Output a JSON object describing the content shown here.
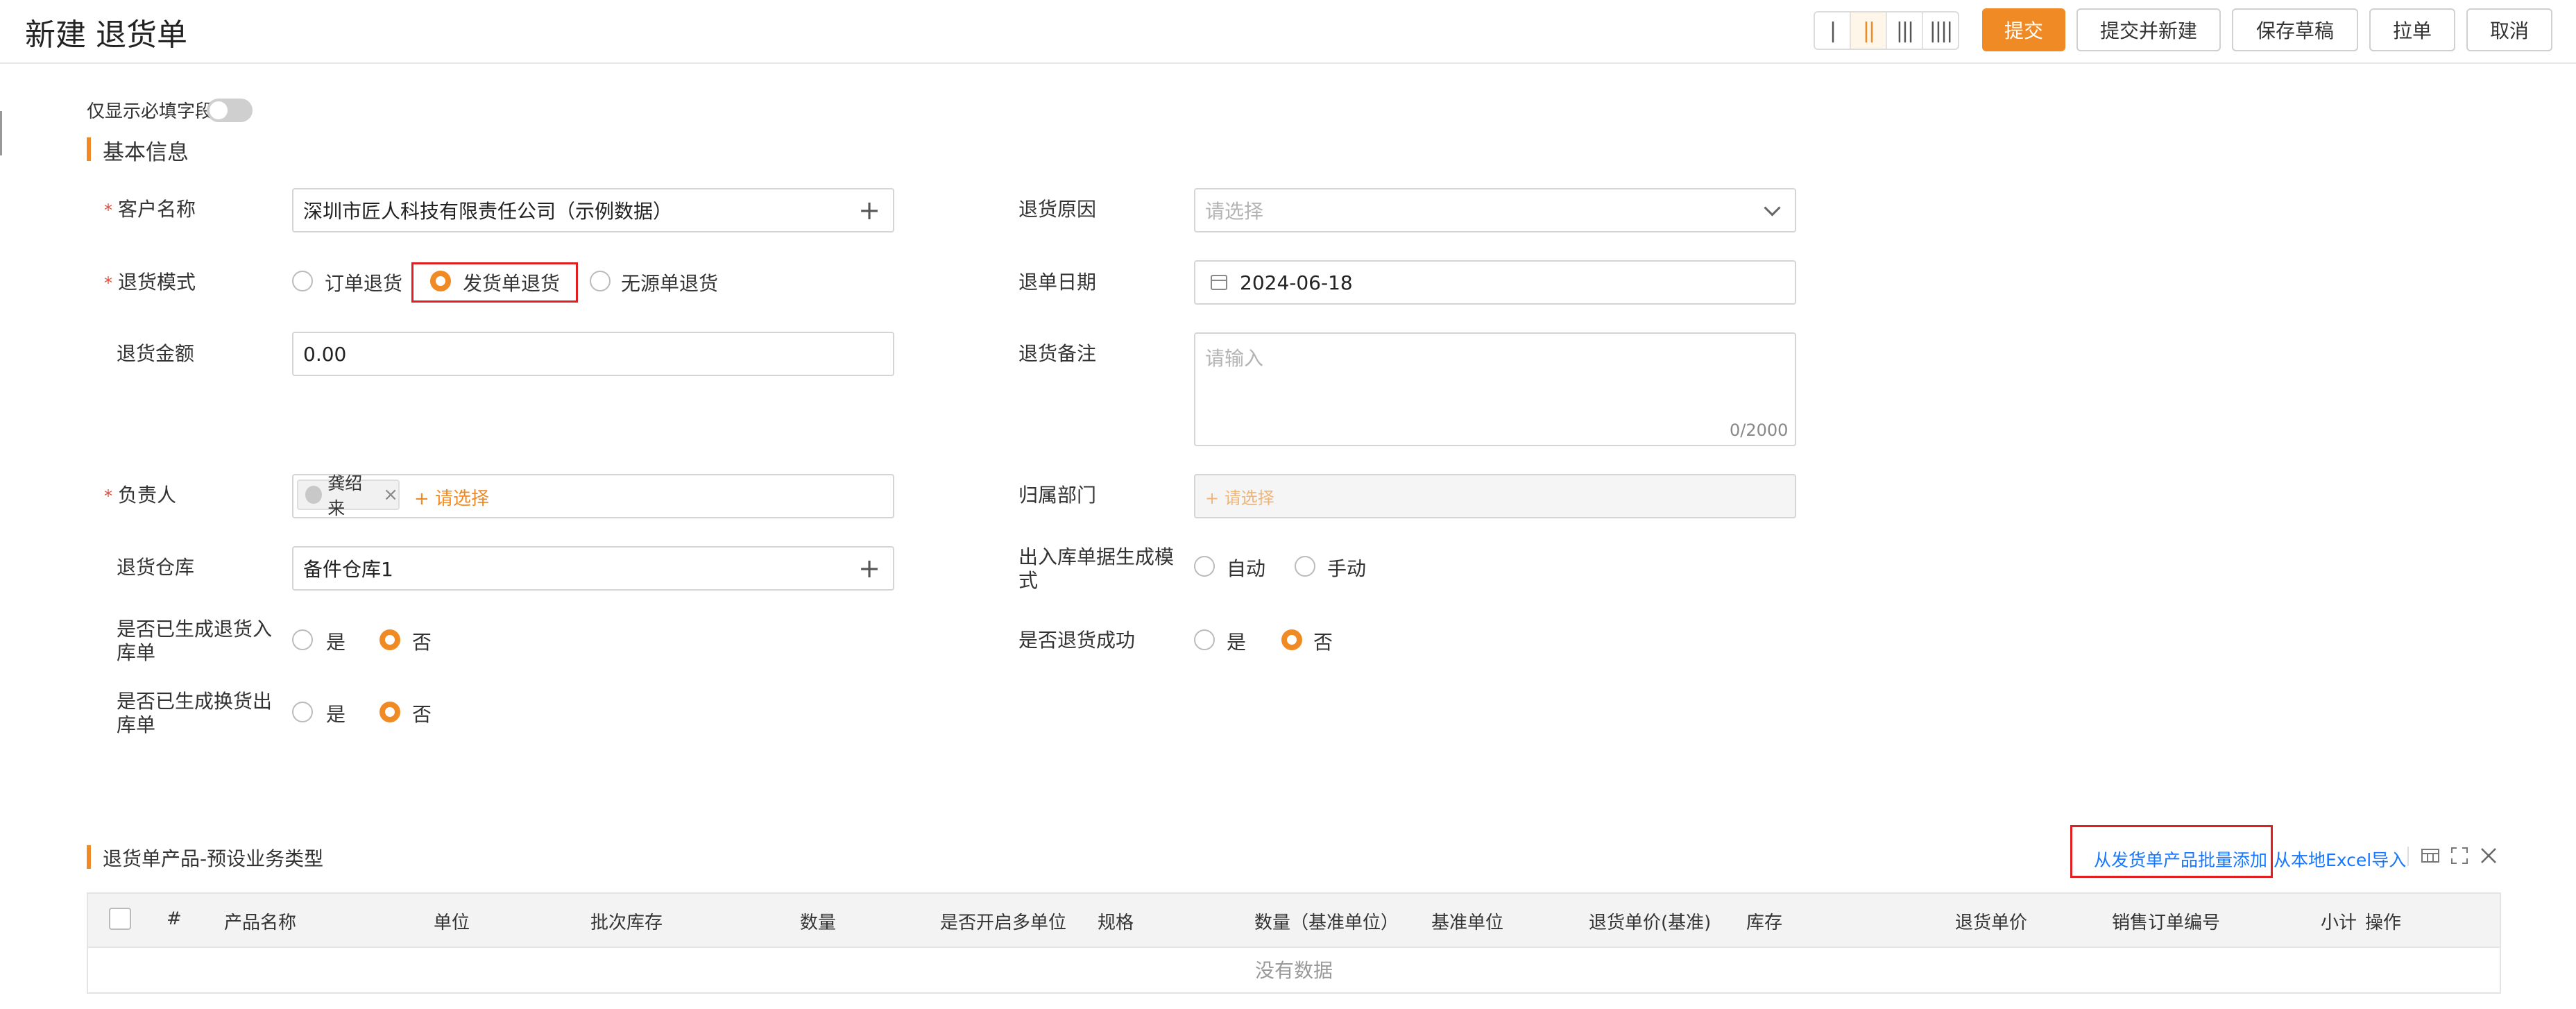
{
  "header": {
    "title": "新建 退货单",
    "layout_options": [
      "|",
      "||",
      "|||",
      "||||"
    ],
    "buttons": {
      "submit": "提交",
      "submit_new": "提交并新建",
      "save_draft": "保存草稿",
      "pull": "拉单",
      "cancel": "取消"
    }
  },
  "toggle": {
    "label": "仅显示必填字段",
    "checked": false
  },
  "basic": {
    "title": "基本信息",
    "customer": {
      "label": "客户名称",
      "value": "深圳市匠人科技有限责任公司（示例数据）"
    },
    "reason": {
      "label": "退货原因",
      "placeholder": "请选择"
    },
    "mode": {
      "label": "退货模式",
      "options": [
        "订单退货",
        "发货单退货",
        "无源单退货"
      ],
      "selected": "发货单退货"
    },
    "date": {
      "label": "退单日期",
      "value": "2024-06-18"
    },
    "amount": {
      "label": "退货金额",
      "value": "0.00"
    },
    "remark": {
      "label": "退货备注",
      "placeholder": "请输入",
      "counter": "0/2000"
    },
    "owner": {
      "label": "负责人",
      "tag": "龚绍来",
      "add": "+ 请选择"
    },
    "dept": {
      "label": "归属部门",
      "add": "+ 请选择"
    },
    "warehouse": {
      "label": "退货仓库",
      "value": "备件仓库1"
    },
    "io_mode": {
      "label_line1": "出入库单据生成模",
      "label_line2": "式",
      "options": [
        "自动",
        "手动"
      ],
      "selected": null
    },
    "gen_in": {
      "label_line1": "是否已生成退货入",
      "label_line2": "库单",
      "options": [
        "是",
        "否"
      ],
      "selected": "否"
    },
    "success": {
      "label": "是否退货成功",
      "options": [
        "是",
        "否"
      ],
      "selected": "否"
    },
    "gen_out": {
      "label_line1": "是否已生成换货出",
      "label_line2": "库单",
      "options": [
        "是",
        "否"
      ],
      "selected": "否"
    }
  },
  "products": {
    "title": "退货单产品-预设业务类型",
    "batch_add": "从发货单产品批量添加",
    "excel_import": "从本地Excel导入",
    "columns": [
      "#",
      "产品名称",
      "单位",
      "批次库存",
      "数量",
      "是否开启多单位",
      "规格",
      "数量（基准单位）",
      "基准单位",
      "退货单价(基准)",
      "库存",
      "退货单价",
      "销售订单编号",
      "小计",
      "操作"
    ],
    "empty": "没有数据"
  },
  "colors": {
    "accent": "#f08a24",
    "required": "#e34d3b",
    "highlight": "#e02020",
    "link": "#1677ff"
  }
}
